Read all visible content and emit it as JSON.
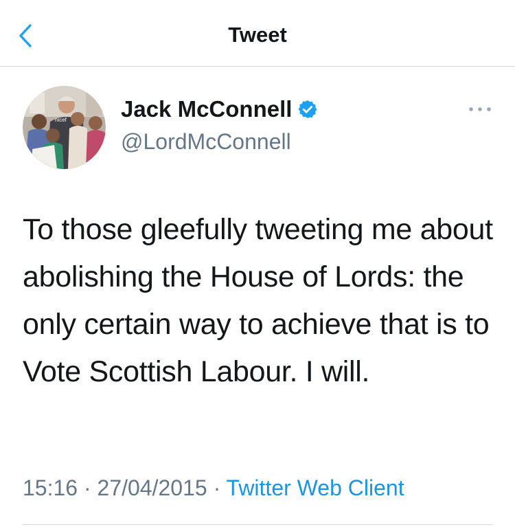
{
  "header": {
    "title": "Tweet",
    "back_icon": "chevron-left-icon"
  },
  "author": {
    "name": "Jack McConnell",
    "handle": "@LordMcConnell",
    "verified": true,
    "avatar_shirt_text": "nicef"
  },
  "tweet": {
    "text": "To those gleefully tweeting me about abolishing the House of Lords: the only certain way to achieve that is to Vote Scottish Labour. I will.",
    "time": "15:16",
    "separator": "·",
    "date": "27/04/2015",
    "source": "Twitter Web Client"
  },
  "colors": {
    "accent": "#1da1f2",
    "link": "#1b95e0",
    "secondary_text": "#657786",
    "primary_text": "#14171a",
    "divider": "#d3d6d9"
  }
}
